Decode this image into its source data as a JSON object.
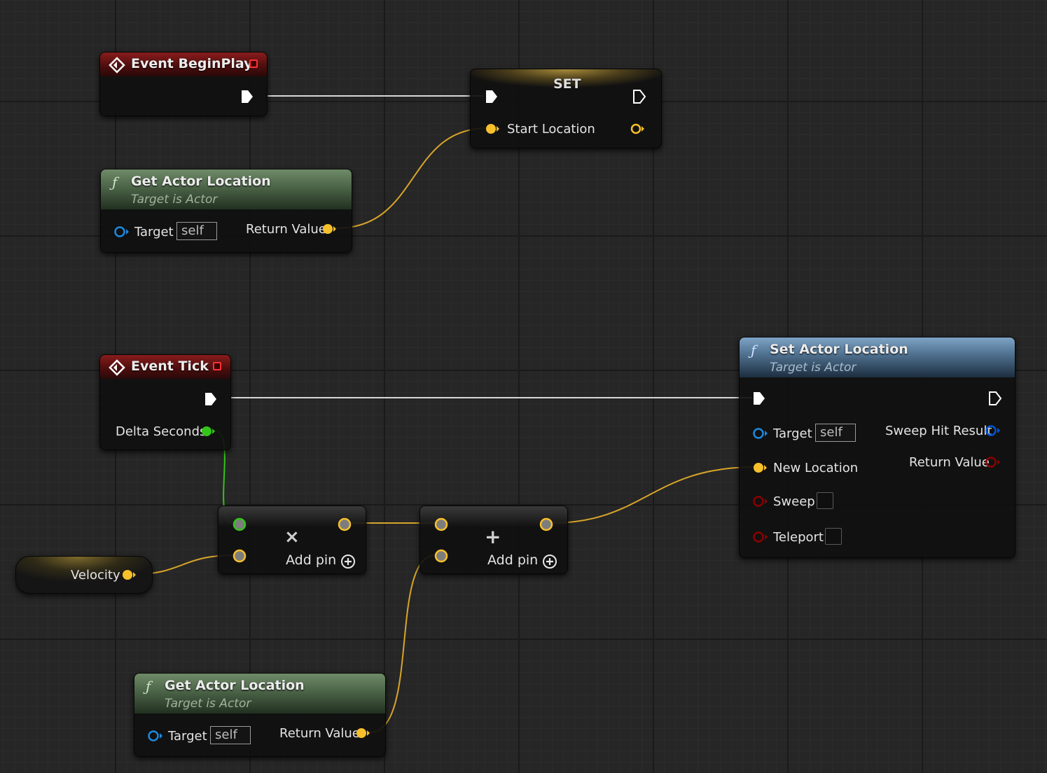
{
  "nodes": {
    "event_begin_play": {
      "title": "Event BeginPlay"
    },
    "set_node": {
      "title": "SET",
      "var_label": "Start Location"
    },
    "get_actor_location_1": {
      "title": "Get Actor Location",
      "subtitle": "Target is Actor",
      "target_label": "Target",
      "target_value": "self",
      "return_label": "Return Value"
    },
    "event_tick": {
      "title": "Event Tick",
      "delta_label": "Delta Seconds"
    },
    "set_actor_location": {
      "title": "Set Actor Location",
      "subtitle": "Target is Actor",
      "target_label": "Target",
      "target_value": "self",
      "sweep_hit_label": "Sweep Hit Result",
      "new_location_label": "New Location",
      "return_label": "Return Value",
      "sweep_label": "Sweep",
      "teleport_label": "Teleport"
    },
    "multiply_node": {
      "op_symbol": "×",
      "add_pin_label": "Add pin"
    },
    "add_node": {
      "op_symbol": "+",
      "add_pin_label": "Add pin"
    },
    "velocity_node": {
      "label": "Velocity"
    },
    "get_actor_location_2": {
      "title": "Get Actor Location",
      "subtitle": "Target is Actor",
      "target_label": "Target",
      "target_value": "self",
      "return_label": "Return Value"
    }
  },
  "colors": {
    "exec": "#ffffff",
    "vector": "#f7c02a",
    "float": "#35c41a",
    "object": "#1b8ae0",
    "struct": "#0055d4",
    "bool": "#8c0000",
    "wildcard": "#8f8f8f"
  }
}
